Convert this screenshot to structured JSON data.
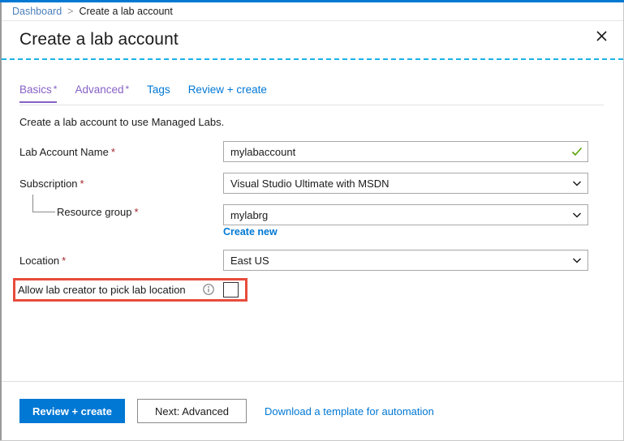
{
  "breadcrumb": {
    "root": "Dashboard",
    "separator": ">",
    "current": "Create a lab account"
  },
  "header": {
    "title": "Create a lab account",
    "close_icon": "close-icon"
  },
  "tabs": [
    {
      "label": "Basics",
      "required": "*",
      "selected": true,
      "color": "#8661c5"
    },
    {
      "label": "Advanced",
      "required": "*",
      "selected": false,
      "color": "#8661c5"
    },
    {
      "label": "Tags",
      "required": "",
      "selected": false,
      "color": "#0078d4"
    },
    {
      "label": "Review + create",
      "required": "",
      "selected": false,
      "color": "#0078d4"
    }
  ],
  "intro": "Create a lab account to use Managed Labs.",
  "fields": {
    "lab_account_name": {
      "label": "Lab Account Name",
      "required": "*",
      "value": "mylabaccount",
      "placeholder": "",
      "validation_icon": "check-icon",
      "validation_color": "#57a300"
    },
    "subscription": {
      "label": "Subscription",
      "required": "*",
      "value": "Visual Studio Ultimate with MSDN",
      "icon": "chevron-down-icon"
    },
    "resource_group": {
      "label": "Resource group",
      "required": "*",
      "value": "mylabrg",
      "icon": "chevron-down-icon",
      "create_new_link": "Create new"
    },
    "location": {
      "label": "Location",
      "required": "*",
      "value": "East US",
      "icon": "chevron-down-icon"
    },
    "allow_lab_creator_location": {
      "label": "Allow lab creator to pick lab location",
      "info_icon": "info-icon",
      "checked": false,
      "highlight_color": "#e74c3c"
    }
  },
  "footer": {
    "review_create_label": "Review + create",
    "next_label": "Next: Advanced",
    "download_template_label": "Download a template for automation"
  },
  "colors": {
    "accent": "#0078d4",
    "tab_purple": "#8661c5",
    "required_red": "#a4262c",
    "success_green": "#57a300",
    "annotation_red": "#e74c3c",
    "focus_dash": "#1ab3e8"
  }
}
